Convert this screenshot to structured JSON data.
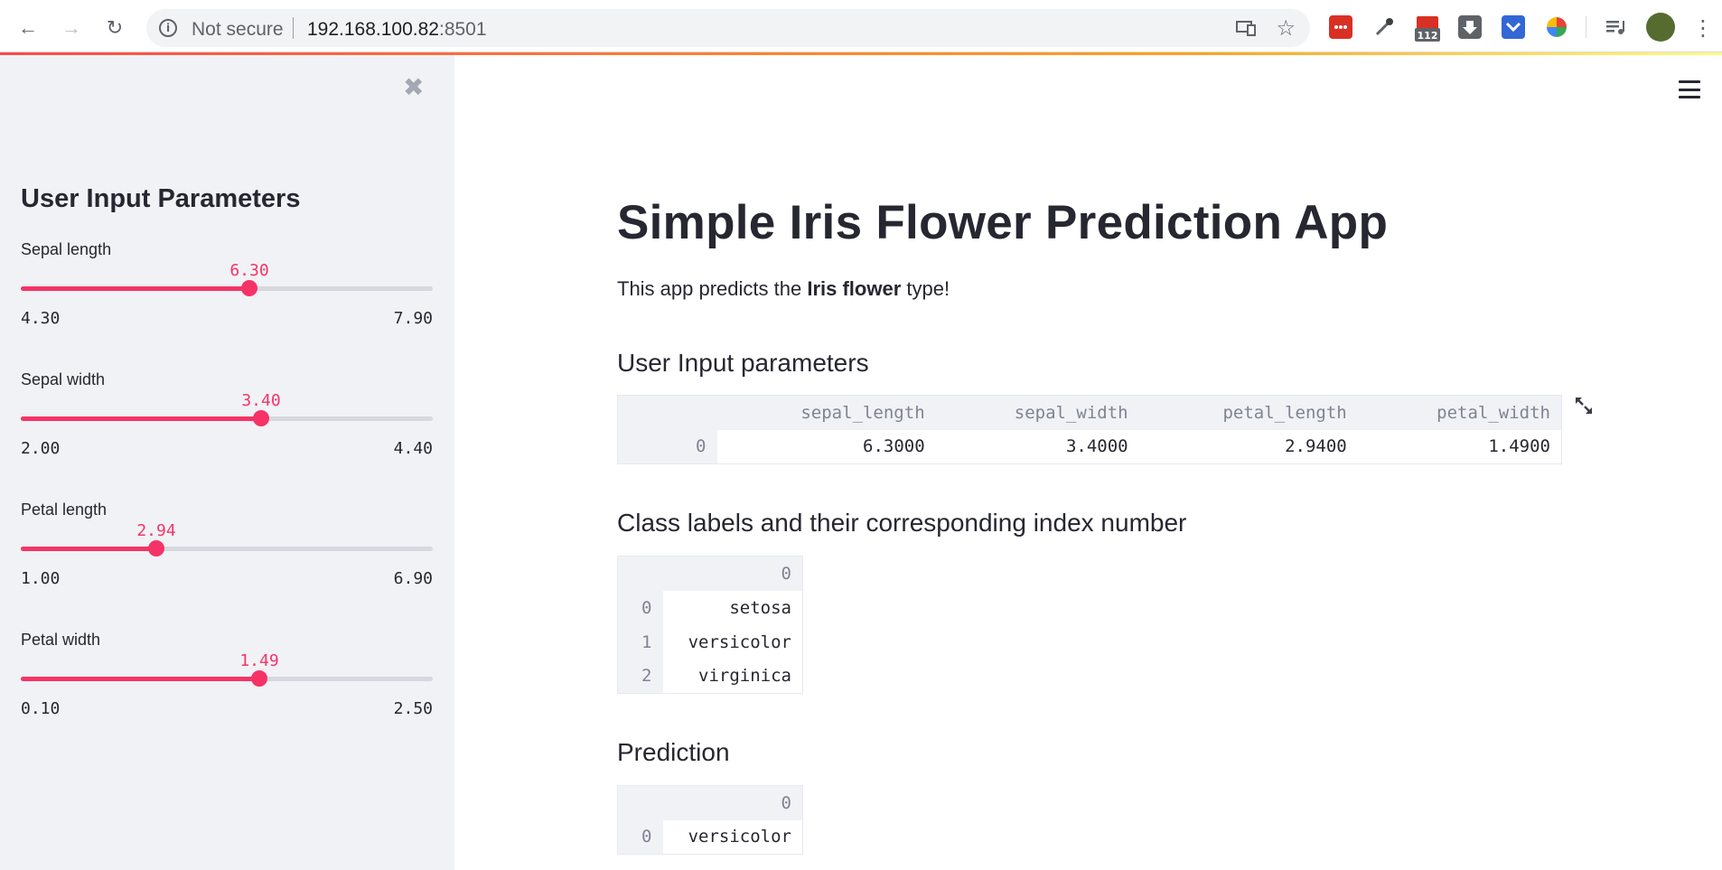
{
  "browser": {
    "security_label": "Not secure",
    "url_host": "192.168.100.82",
    "url_port": ":8501",
    "extension_badge": "112"
  },
  "sidebar": {
    "heading": "User Input Parameters",
    "sliders": [
      {
        "label": "Sepal length",
        "value": "6.30",
        "min": "4.30",
        "max": "7.90",
        "fraction": 0.5556
      },
      {
        "label": "Sepal width",
        "value": "3.40",
        "min": "2.00",
        "max": "4.40",
        "fraction": 0.5833
      },
      {
        "label": "Petal length",
        "value": "2.94",
        "min": "1.00",
        "max": "6.90",
        "fraction": 0.3288
      },
      {
        "label": "Petal width",
        "value": "1.49",
        "min": "0.10",
        "max": "2.50",
        "fraction": 0.5792
      }
    ]
  },
  "main": {
    "title": "Simple Iris Flower Prediction App",
    "intro_before": "This app predicts the ",
    "intro_bold": "Iris flower",
    "intro_after": " type!",
    "section_input": "User Input parameters",
    "section_classes": "Class labels and their corresponding index number",
    "section_prediction": "Prediction"
  },
  "input_table": {
    "columns": [
      "sepal_length",
      "sepal_width",
      "petal_length",
      "petal_width"
    ],
    "rows": [
      {
        "index": "0",
        "cells": [
          "6.3000",
          "3.4000",
          "2.9400",
          "1.4900"
        ]
      }
    ]
  },
  "class_table": {
    "column": "0",
    "rows": [
      {
        "index": "0",
        "value": "setosa"
      },
      {
        "index": "1",
        "value": "versicolor"
      },
      {
        "index": "2",
        "value": "virginica"
      }
    ]
  },
  "prediction_table": {
    "column": "0",
    "rows": [
      {
        "index": "0",
        "value": "versicolor"
      }
    ]
  },
  "colors": {
    "accent": "#f63366",
    "sidebar_bg": "#f0f2f6",
    "text": "#262730"
  }
}
